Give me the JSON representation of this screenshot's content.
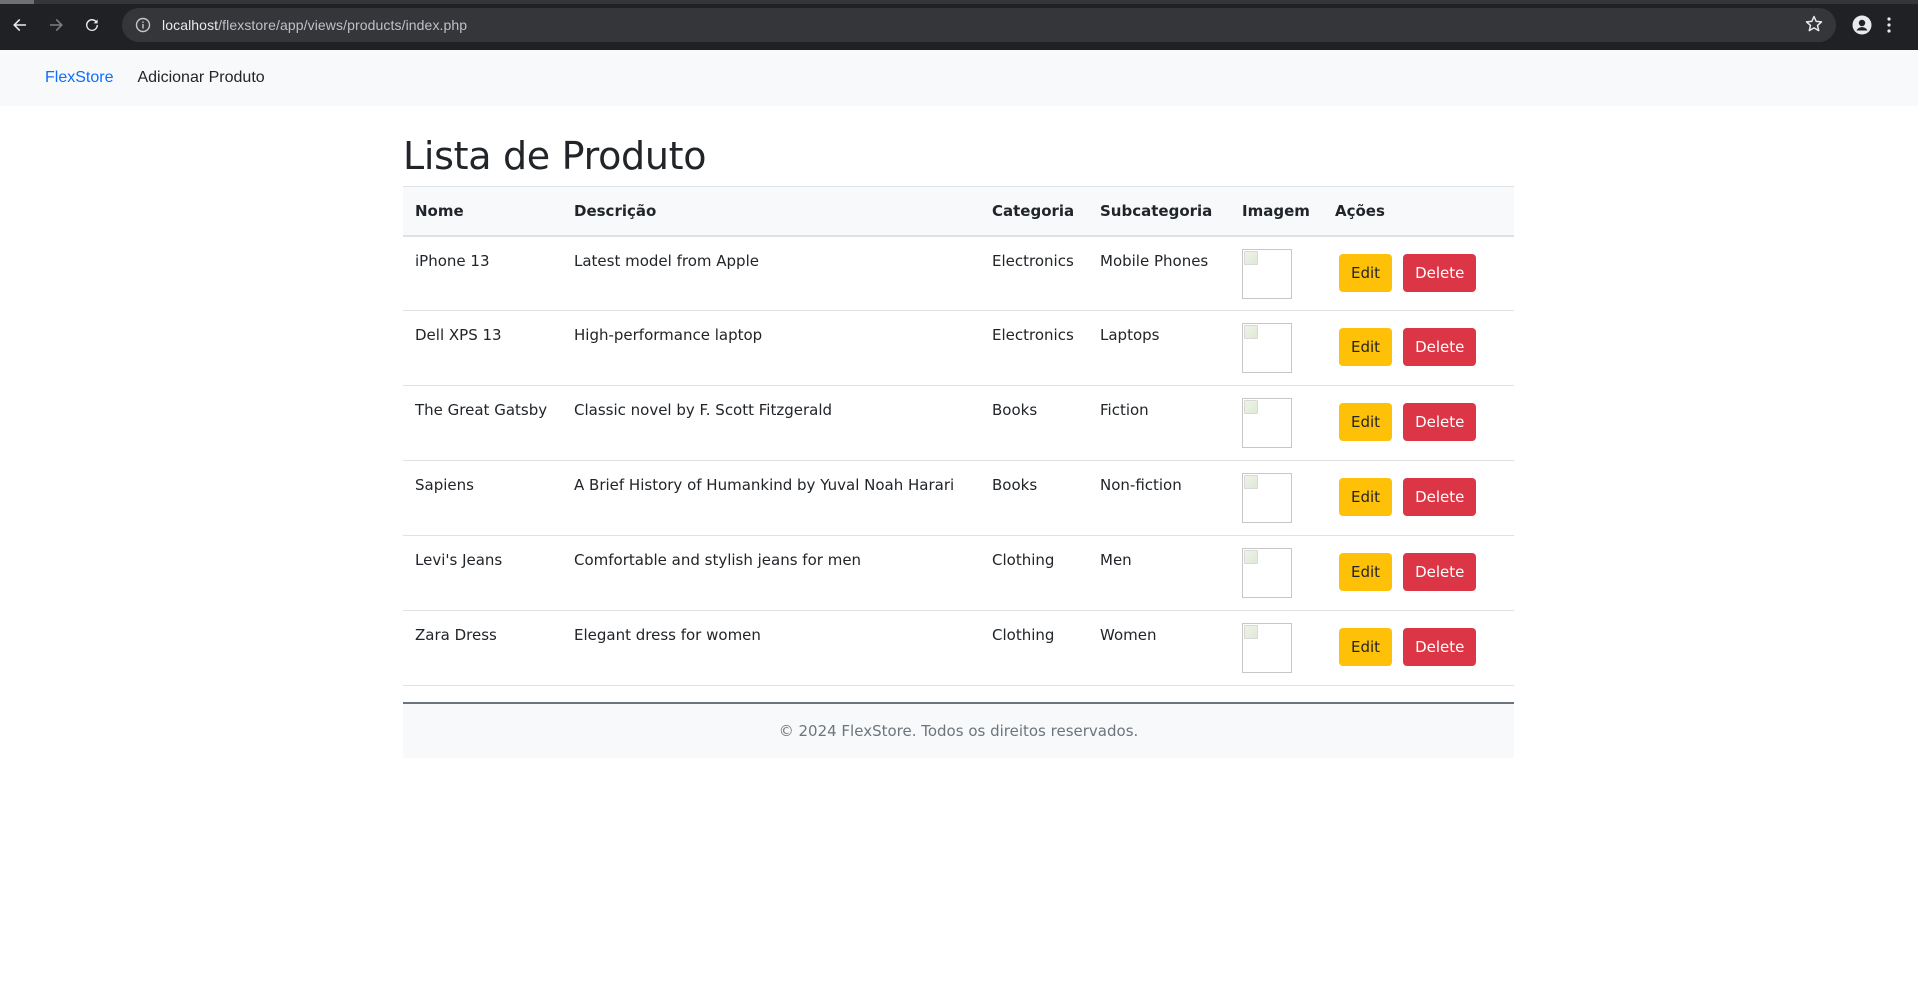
{
  "browser": {
    "url_host": "localhost",
    "url_path": "/flexstore/app/views/products/index.php"
  },
  "navbar": {
    "brand": "FlexStore",
    "links": [
      "Adicionar Produto"
    ]
  },
  "page": {
    "title": "Lista de Produto"
  },
  "table": {
    "headers": [
      "Nome",
      "Descrição",
      "Categoria",
      "Subcategoria",
      "Imagem",
      "Ações"
    ],
    "rows": [
      {
        "nome": "iPhone 13",
        "descricao": "Latest model from Apple",
        "categoria": "Electronics",
        "subcategoria": "Mobile Phones"
      },
      {
        "nome": "Dell XPS 13",
        "descricao": "High-performance laptop",
        "categoria": "Electronics",
        "subcategoria": "Laptops"
      },
      {
        "nome": "The Great Gatsby",
        "descricao": "Classic novel by F. Scott Fitzgerald",
        "categoria": "Books",
        "subcategoria": "Fiction"
      },
      {
        "nome": "Sapiens",
        "descricao": "A Brief History of Humankind by Yuval Noah Harari",
        "categoria": "Books",
        "subcategoria": "Non-fiction"
      },
      {
        "nome": "Levi's Jeans",
        "descricao": "Comfortable and stylish jeans for men",
        "categoria": "Clothing",
        "subcategoria": "Men"
      },
      {
        "nome": "Zara Dress",
        "descricao": "Elegant dress for women",
        "categoria": "Clothing",
        "subcategoria": "Women"
      }
    ],
    "edit_label": "Edit",
    "delete_label": "Delete"
  },
  "footer": {
    "text": "© 2024 FlexStore. Todos os direitos reservados."
  },
  "colors": {
    "brand_link": "#0d6efd",
    "edit_button": "#ffc107",
    "delete_button": "#dc3545",
    "chrome_dark": "#202124"
  },
  "icons": [
    "back-arrow-icon",
    "forward-arrow-icon",
    "reload-icon",
    "site-info-icon",
    "bookmark-star-icon",
    "profile-icon",
    "kebab-menu-icon"
  ]
}
